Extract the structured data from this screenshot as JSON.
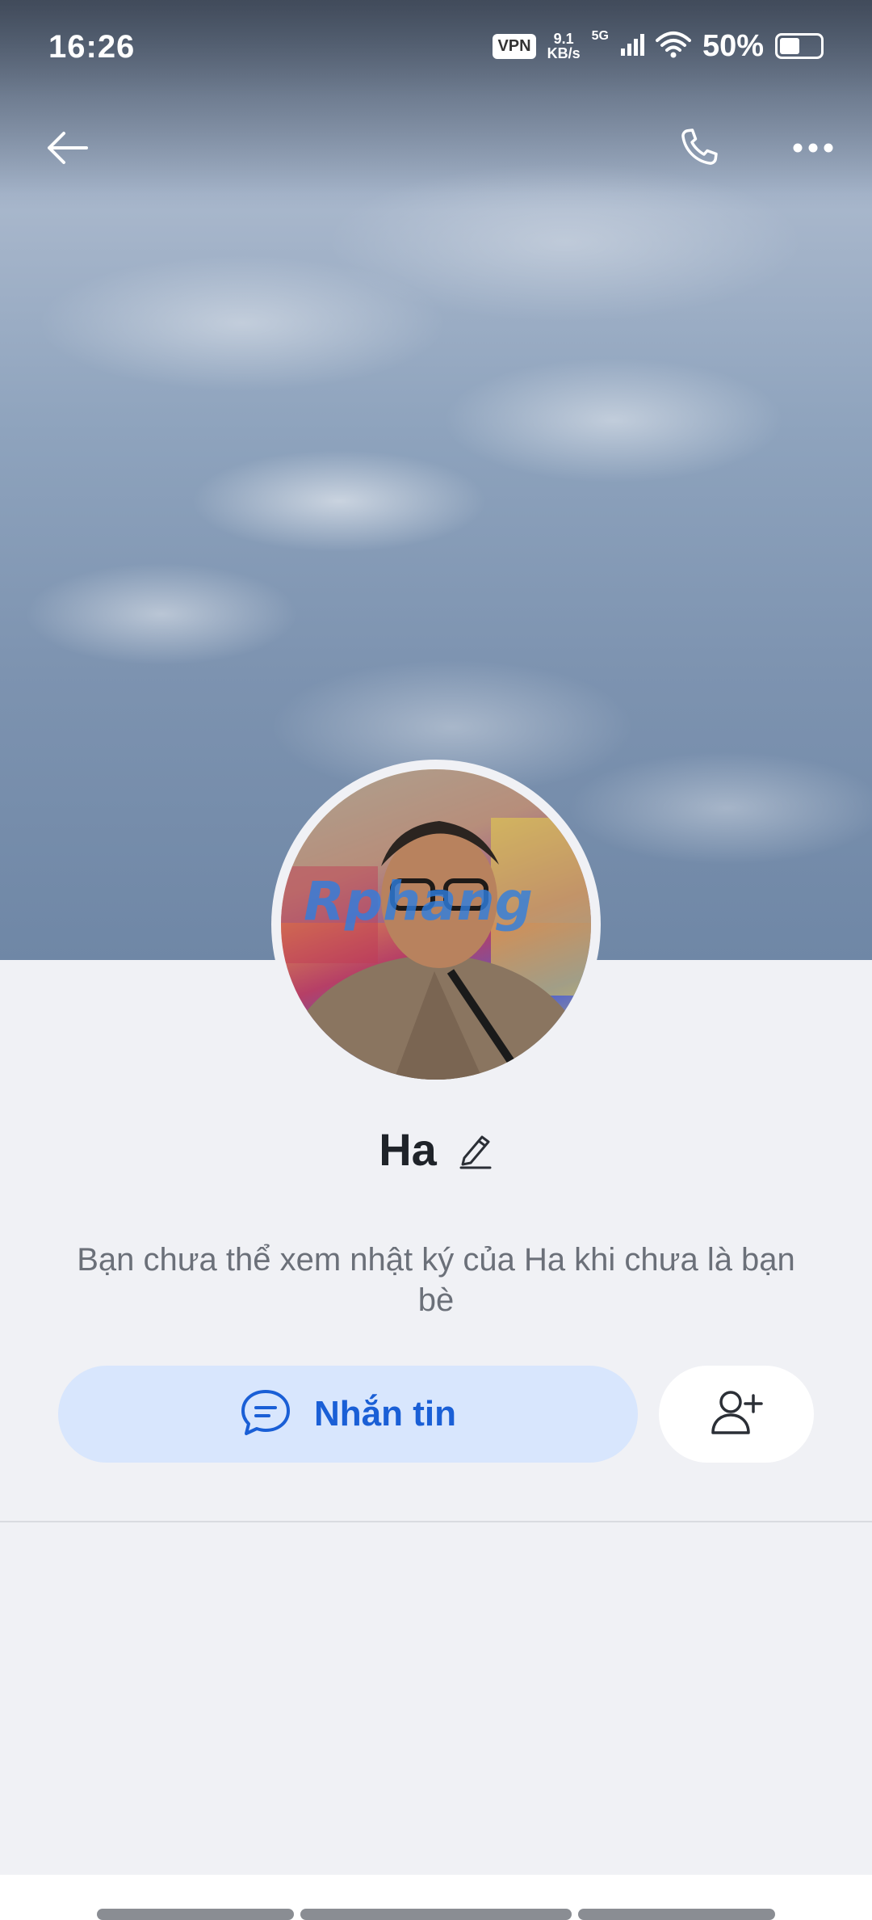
{
  "status_bar": {
    "time": "16:26",
    "vpn": "VPN",
    "net_speed_value": "9.1",
    "net_speed_unit": "KB/s",
    "network": "5G",
    "battery_percent": "50%",
    "battery_level": 0.5
  },
  "profile": {
    "name": "Ha",
    "avatar_watermark": "Rphang",
    "notice": "Bạn chưa thể xem nhật ký của Ha khi chưa là bạn bè"
  },
  "actions": {
    "message_label": "Nhắn tin"
  },
  "icons": {
    "back": "arrow-left-icon",
    "call": "phone-icon",
    "more": "more-horizontal-icon",
    "edit": "pencil-icon",
    "message": "chat-bubble-icon",
    "add_friend": "add-user-icon"
  },
  "colors": {
    "accent": "#1a5fd6",
    "message_button_bg": "#d8e6fd",
    "panel_bg": "#f0f1f5"
  }
}
